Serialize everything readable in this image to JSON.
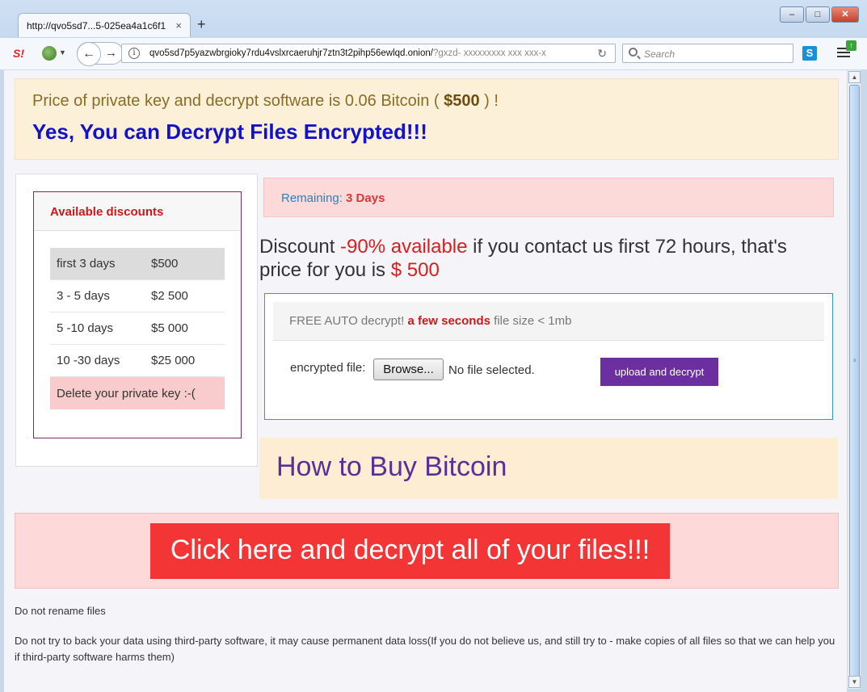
{
  "browser": {
    "tab_title": "http://qvo5sd7...5-025ea4a1c6f1",
    "tab_close": "×",
    "new_tab": "+",
    "url_main": "qvo5sd7p5yazwbrgioky7rdu4vslxrcaeruhjr7ztn3t2pihp56ewlqd.onion/",
    "url_rest": "?gxzd-  xxxxxxxxx  xxx xxx-x",
    "search_placeholder": "Search",
    "window_buttons": {
      "minimize": "–",
      "maximize": "□",
      "close": "✕"
    }
  },
  "page": {
    "price_line_prefix": "Price of private key and decrypt software is 0.06 Bitcoin ( ",
    "price_amount": "$500",
    "price_line_suffix": " ) !",
    "headline": "Yes, You can Decrypt Files Encrypted!!!",
    "discounts": {
      "title": "Available discounts",
      "rows": [
        {
          "period": "first 3 days",
          "price": "$500"
        },
        {
          "period": "3 - 5 days",
          "price": "$2 500"
        },
        {
          "period": "5 -10 days",
          "price": "$5 000"
        },
        {
          "period": "10 -30 days",
          "price": "$25 000"
        }
      ],
      "footer": "Delete your private key :-("
    },
    "remaining_label": "Remaining: ",
    "remaining_value": "3 Days",
    "discount_prefix": "Discount ",
    "discount_highlight": "-90% available",
    "discount_middle": " if you contact us first 72 hours, that's price for you is ",
    "discount_price": "$ 500",
    "auto_decrypt_prefix": "FREE AUTO decrypt! ",
    "auto_decrypt_highlight": "a few seconds",
    "auto_decrypt_suffix": " file size < 1mb",
    "encrypted_file_label": "encrypted file:",
    "browse_label": "Browse...",
    "no_file": "No file selected.",
    "upload_button": "upload and decrypt",
    "how_to_buy": "How to Buy Bitcoin",
    "click_here": "Click here and decrypt all of your files!!!",
    "notes": [
      "Do not rename files",
      "Do not try to back your data using third-party software, it may cause permanent data loss(If you do not believe us, and still try to - make copies of all files so that we can help you if third-party software harms them)"
    ]
  },
  "colors": {
    "headline": "#1212c8",
    "accent_red": "#d81e1e",
    "upload_button": "#6c2fa0",
    "click_button": "#f43535",
    "how_to_text": "#5b2f98"
  }
}
